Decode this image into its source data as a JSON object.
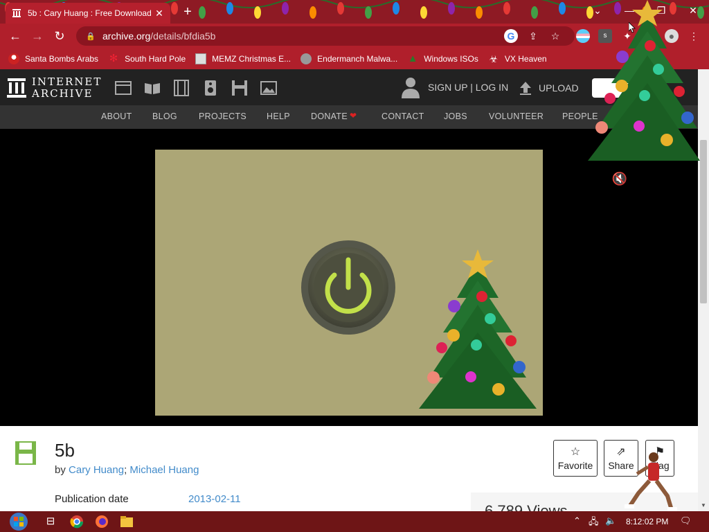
{
  "browser": {
    "tab_title": "5b : Cary Huang : Free Download",
    "url_host": "archive.org",
    "url_path": "/details/bfdia5b",
    "bookmarks": [
      {
        "label": "Santa Bombs Arabs",
        "icon": "santa-icon"
      },
      {
        "label": "South Hard Pole",
        "icon": "snowflake-icon"
      },
      {
        "label": "MEMZ Christmas E...",
        "icon": "memz-icon"
      },
      {
        "label": "Endermanch Malwa...",
        "icon": "raccoon-icon"
      },
      {
        "label": "Windows ISOs",
        "icon": "tree-icon"
      },
      {
        "label": "VX Heaven",
        "icon": "biohazard-icon"
      }
    ]
  },
  "ia": {
    "logo_line1": "INTERNET",
    "logo_line2": "ARCHIVE",
    "signup": "SIGN UP | LOG IN",
    "upload": "UPLOAD",
    "nav": [
      "ABOUT",
      "BLOG",
      "PROJECTS",
      "HELP",
      "DONATE",
      "CONTACT",
      "JOBS",
      "VOLUNTEER",
      "PEOPLE"
    ]
  },
  "item": {
    "title": "5b",
    "by_prefix": "by",
    "authors": [
      "Cary Huang",
      "Michael Huang"
    ],
    "author_sep": ";",
    "pub_label": "Publication date",
    "pub_value": "2013-02-11",
    "views": "6,789 Views",
    "actions": {
      "favorite": "Favorite",
      "share": "Share",
      "flag": "Flag"
    }
  },
  "taskbar": {
    "clock": "8:12:02 PM"
  },
  "colors": {
    "chrome_red": "#b01f2b",
    "ia_dark": "#222222",
    "link_blue": "#428bca",
    "player_bg": "#aca676"
  }
}
